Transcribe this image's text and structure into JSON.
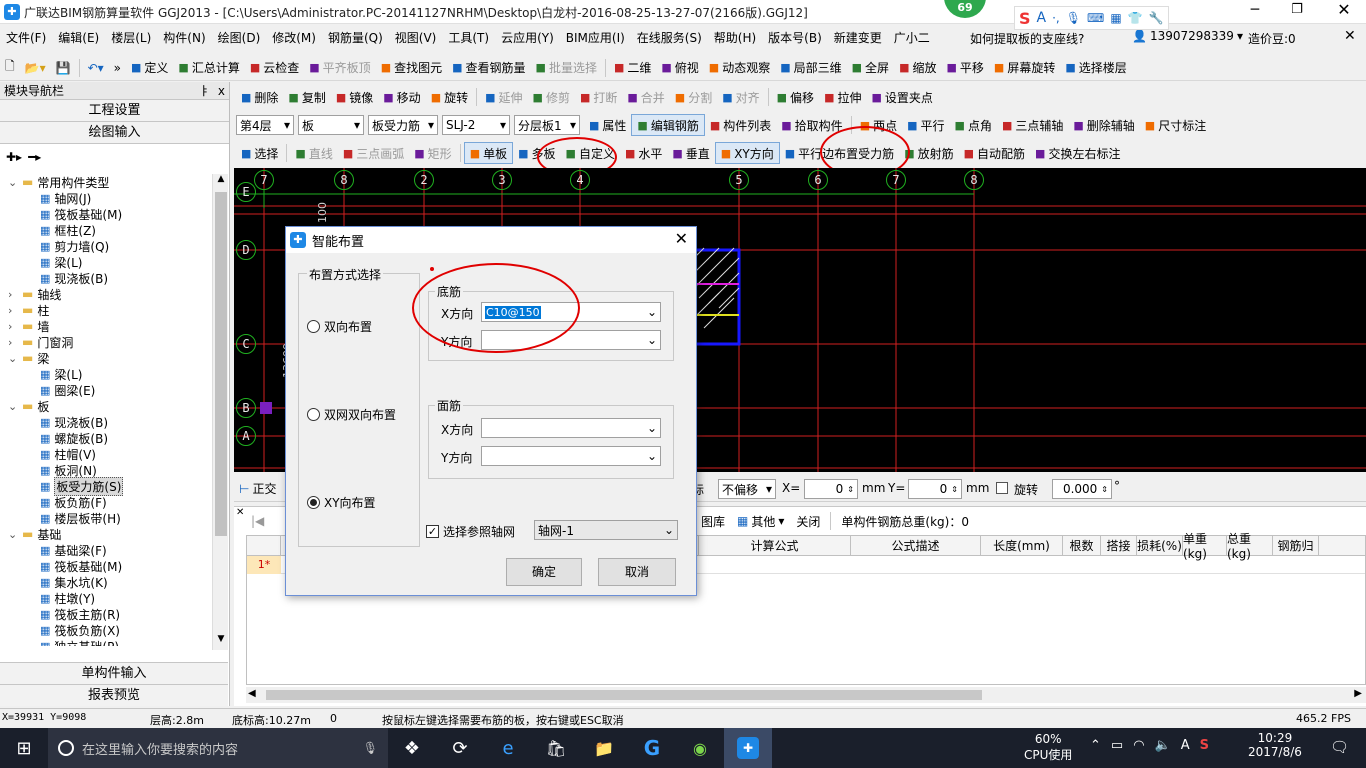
{
  "titlebar": {
    "title": "广联达BIM钢筋算量软件 GGJ2013 - [C:\\Users\\Administrator.PC-20141127NRHM\\Desktop\\白龙村-2016-08-25-13-27-07(2166版).GGJ12]",
    "badge": "69"
  },
  "menu": {
    "items": [
      "文件(F)",
      "编辑(E)",
      "楼层(L)",
      "构件(N)",
      "绘图(D)",
      "修改(M)",
      "钢筋量(Q)",
      "视图(V)",
      "工具(T)",
      "云应用(Y)",
      "BIM应用(I)",
      "在线服务(S)",
      "帮助(H)",
      "版本号(B)",
      "新建变更",
      "广小二"
    ],
    "question": "如何提取板的支座线?",
    "phone": "13907298339",
    "coins": "造价豆:0"
  },
  "toolbar1": [
    "定义",
    "汇总计算",
    "云检查",
    "平齐板顶",
    "查找图元",
    "查看钢筋量",
    "批量选择",
    "二维",
    "俯视",
    "动态观察",
    "局部三维",
    "全屏",
    "缩放",
    "平移",
    "屏幕旋转",
    "选择楼层"
  ],
  "toolbar2": [
    "删除",
    "复制",
    "镜像",
    "移动",
    "旋转",
    "延伸",
    "修剪",
    "打断",
    "合并",
    "分割",
    "对齐",
    "偏移",
    "拉伸",
    "设置夹点"
  ],
  "toolbar3": {
    "floor": "第4层",
    "category": "板",
    "type": "板受力筋",
    "rebar": "SLJ-2",
    "layer": "分层板1",
    "buttons": [
      "属性",
      "编辑钢筋",
      "构件列表",
      "拾取构件",
      "两点",
      "平行",
      "点角",
      "三点辅轴",
      "删除辅轴",
      "尺寸标注"
    ]
  },
  "toolbar4": [
    "选择",
    "直线",
    "三点画弧",
    "矩形",
    "单板",
    "多板",
    "自定义",
    "水平",
    "垂直",
    "XY方向",
    "平行边布置受力筋",
    "放射筋",
    "自动配筋",
    "交换左右标注"
  ],
  "sidebar": {
    "title": "模块导航栏",
    "pin": "ㅑ",
    "close": "x",
    "section1": "工程设置",
    "section2": "绘图输入",
    "tree": [
      {
        "level": 0,
        "label": "常用构件类型",
        "folder": true,
        "open": true
      },
      {
        "level": 1,
        "label": "轴网(J)"
      },
      {
        "level": 1,
        "label": "筏板基础(M)"
      },
      {
        "level": 1,
        "label": "框柱(Z)"
      },
      {
        "level": 1,
        "label": "剪力墙(Q)"
      },
      {
        "level": 1,
        "label": "梁(L)"
      },
      {
        "level": 1,
        "label": "现浇板(B)"
      },
      {
        "level": 0,
        "label": "轴线",
        "folder": true,
        "open": false
      },
      {
        "level": 0,
        "label": "柱",
        "folder": true,
        "open": false
      },
      {
        "level": 0,
        "label": "墙",
        "folder": true,
        "open": false
      },
      {
        "level": 0,
        "label": "门窗洞",
        "folder": true,
        "open": false
      },
      {
        "level": 0,
        "label": "梁",
        "folder": true,
        "open": true
      },
      {
        "level": 1,
        "label": "梁(L)"
      },
      {
        "level": 1,
        "label": "圈梁(E)"
      },
      {
        "level": 0,
        "label": "板",
        "folder": true,
        "open": true
      },
      {
        "level": 1,
        "label": "现浇板(B)"
      },
      {
        "level": 1,
        "label": "螺旋板(B)"
      },
      {
        "level": 1,
        "label": "柱帽(V)"
      },
      {
        "level": 1,
        "label": "板洞(N)"
      },
      {
        "level": 1,
        "label": "板受力筋(S)",
        "selected": true
      },
      {
        "level": 1,
        "label": "板负筋(F)"
      },
      {
        "level": 1,
        "label": "楼层板带(H)"
      },
      {
        "level": 0,
        "label": "基础",
        "folder": true,
        "open": true
      },
      {
        "level": 1,
        "label": "基础梁(F)"
      },
      {
        "level": 1,
        "label": "筏板基础(M)"
      },
      {
        "level": 1,
        "label": "集水坑(K)"
      },
      {
        "level": 1,
        "label": "柱墩(Y)"
      },
      {
        "level": 1,
        "label": "筏板主筋(R)"
      },
      {
        "level": 1,
        "label": "筏板负筋(X)"
      },
      {
        "level": 1,
        "label": "独立基础(P)"
      }
    ],
    "bottom1": "单构件输入",
    "bottom2": "报表预览"
  },
  "canvas": {
    "top_axes": [
      "7",
      "8",
      "2",
      "3",
      "4",
      "5",
      "6",
      "7",
      "8"
    ],
    "left_axes": [
      "E",
      "D",
      "C",
      "B",
      "A"
    ],
    "dim1": "100",
    "dim2": "13600"
  },
  "snapbar": {
    "start": "正交",
    "label_biao": "标",
    "offset": "不偏移",
    "x_label": "X=",
    "x_value": "0",
    "mm1": "mm",
    "y_label": "Y=",
    "y_value": "0",
    "mm2": "mm",
    "rotate": "旋转",
    "rotate_value": "0.000",
    "degree": "°"
  },
  "grid": {
    "toolbar": {
      "lib": "图库",
      "other": "其他",
      "close": "关闭",
      "total": "单构件钢筋总重(kg)：0"
    },
    "columns": [
      "计算公式",
      "公式描述",
      "长度(mm)",
      "根数",
      "搭接",
      "损耗(%)",
      "单重(kg)",
      "总重(kg)",
      "钢筋归"
    ],
    "row1": "1*"
  },
  "dialog": {
    "title": "智能布置",
    "group_left": "布置方式选择",
    "options": [
      "双向布置",
      "双网双向布置",
      "XY向布置"
    ],
    "group_bottom": "底筋",
    "x_label": "X方向",
    "x_value": "C10@150",
    "y_label": "Y方向",
    "y_value": "",
    "group_top": "面筋",
    "x2_label": "X方向",
    "y2_label": "Y方向",
    "checkbox_label": "选择参照轴网",
    "axis_combo": "轴网-1",
    "ok": "确定",
    "cancel": "取消"
  },
  "statusbar": {
    "coords": "X=39931 Y=9098",
    "floor_height": "层高:2.8m",
    "base_height": "底标高:10.27m",
    "count": "0",
    "hint": "按鼠标左键选择需要布筋的板，按右键或ESC取消",
    "fps": "465.2 FPS"
  },
  "taskbar": {
    "search_placeholder": "在这里输入你要搜索的内容",
    "cpu_percent": "60%",
    "cpu_label": "CPU使用",
    "time": "10:29",
    "date": "2017/8/6",
    "ime": "A"
  },
  "colors": {
    "canvas_bg": "#000000",
    "grid_red": "#d02020",
    "selection_blue": "#1818ff",
    "annotation_red": "#e00000",
    "taskbar_bg": "#1a1f2b"
  }
}
